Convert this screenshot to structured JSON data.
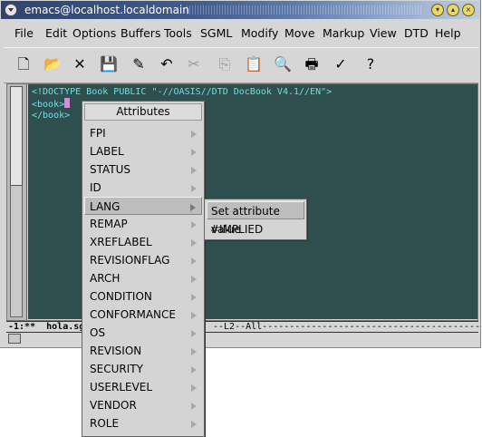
{
  "window": {
    "title": "emacs@localhost.localdomain"
  },
  "menubar": [
    "File",
    "Edit",
    "Options",
    "Buffers",
    "Tools",
    "SGML",
    "Modify",
    "Move",
    "Markup",
    "View",
    "DTD",
    "Help"
  ],
  "toolbar": [
    {
      "icon": "new-file-icon",
      "glyph": "🗋",
      "enabled": true
    },
    {
      "icon": "open-folder-icon",
      "glyph": "📂",
      "enabled": true
    },
    {
      "icon": "close-x-icon",
      "glyph": "✕",
      "enabled": true
    },
    {
      "icon": "save-disk-icon",
      "glyph": "💾",
      "enabled": true
    },
    {
      "icon": "save-as-icon",
      "glyph": "✎",
      "enabled": true
    },
    {
      "icon": "undo-icon",
      "glyph": "↶",
      "enabled": true
    },
    {
      "icon": "cut-scissors-icon",
      "glyph": "✂",
      "enabled": false
    },
    {
      "icon": "copy-icon",
      "glyph": "⎘",
      "enabled": false
    },
    {
      "icon": "paste-icon",
      "glyph": "📋",
      "enabled": false
    },
    {
      "icon": "search-icon",
      "glyph": "🔍",
      "enabled": true
    },
    {
      "icon": "print-icon",
      "glyph": "🖶",
      "enabled": true
    },
    {
      "icon": "customize-icon",
      "glyph": "✓",
      "enabled": true
    },
    {
      "icon": "help-icon",
      "glyph": "?",
      "enabled": true
    }
  ],
  "editor": {
    "lines": [
      "<!DOCTYPE Book PUBLIC \"-//OASIS//DTD DocBook V4.1//EN\">",
      "<book>",
      "</book>"
    ]
  },
  "modeline": {
    "left": "-1:**  hola.sg",
    "right": "--L2--All-------------------------------------------"
  },
  "popup": {
    "title": "Attributes",
    "items": [
      "FPI",
      "LABEL",
      "STATUS",
      "ID",
      "LANG",
      "REMAP",
      "XREFLABEL",
      "REVISIONFLAG",
      "ARCH",
      "CONDITION",
      "CONFORMANCE",
      "OS",
      "REVISION",
      "SECURITY",
      "USERLEVEL",
      "VENDOR",
      "ROLE"
    ],
    "active_index": 4
  },
  "submenu": {
    "items": [
      "Set attribute value",
      "#IMPLIED"
    ],
    "active_index": 0
  }
}
